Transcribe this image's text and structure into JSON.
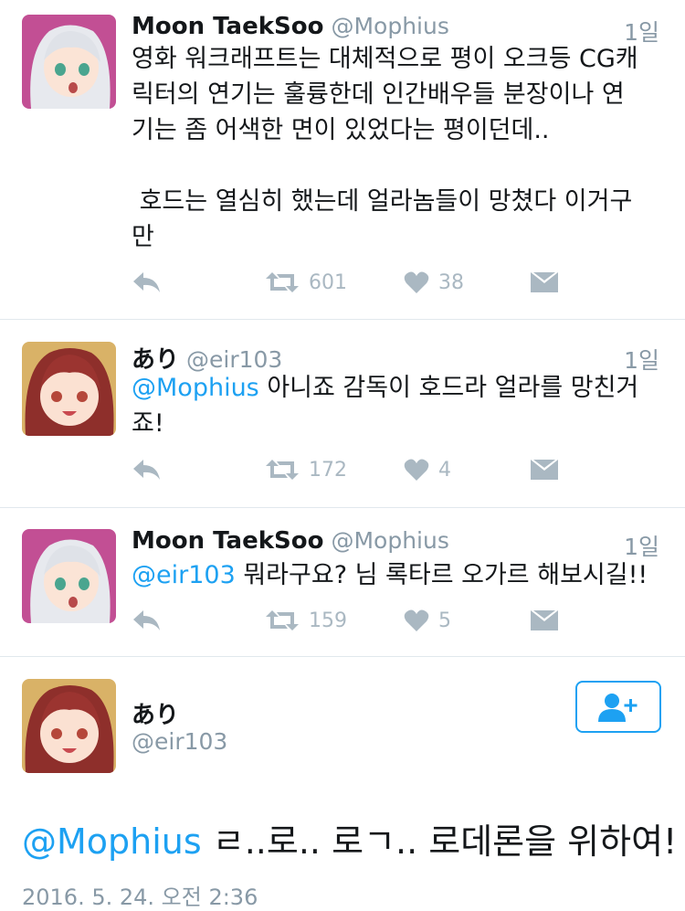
{
  "tweets": [
    {
      "name": "Moon TaekSoo",
      "handle": "@Mophius",
      "time": "1일",
      "mention": "",
      "text": "영화 워크래프트는 대체적으로 평이 오크등 CG캐\n릭터의 연기는 훌륭한데 인간배우들 분장이나 연\n기는 좀 어색한 면이 있었다는 평이던데..\n\n 호드는 열심히 했는데 얼라놈들이 망쳤다 이거구\n만",
      "retweets": "601",
      "likes": "38"
    },
    {
      "name": "あり",
      "handle": "@eir103",
      "time": "1일",
      "mention": "@Mophius",
      "text": " 아니죠 감독이 호드라 얼라를 망친거\n죠!",
      "retweets": "172",
      "likes": "4"
    },
    {
      "name": "Moon TaekSoo",
      "handle": "@Mophius",
      "time": "1일",
      "mention": "@eir103",
      "text": " 뭐라구요? 님 록타르 오가르 해보시길!!",
      "retweets": "159",
      "likes": "5"
    }
  ],
  "focus": {
    "name": "あり",
    "handle": "@eir103",
    "mention": "@Mophius",
    "text": " ㄹ..로.. 로ㄱ.. 로데론을 위하여!",
    "date": "2016. 5. 24. 오전 2:36"
  },
  "colors": {
    "accent": "#1da1f2",
    "muted": "#8899a6",
    "icon": "#aab8c2",
    "divider": "#e1e8ed"
  },
  "icons": [
    "reply-icon",
    "retweet-icon",
    "like-icon",
    "message-icon",
    "follow-icon"
  ]
}
